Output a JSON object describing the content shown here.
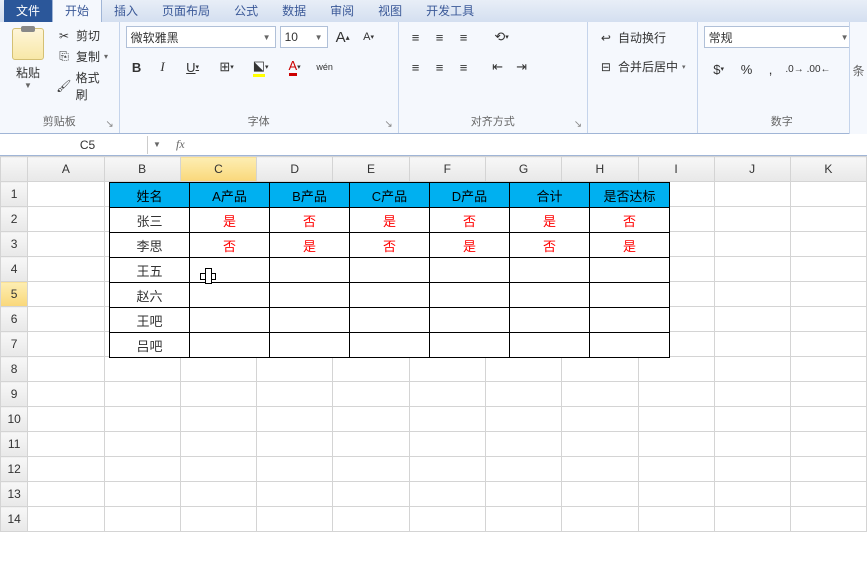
{
  "tabs": {
    "file": "文件",
    "home": "开始",
    "insert": "插入",
    "layout": "页面布局",
    "formula": "公式",
    "data": "数据",
    "review": "审阅",
    "view": "视图",
    "dev": "开发工具"
  },
  "clipboard": {
    "paste": "粘贴",
    "cut": "剪切",
    "copy": "复制",
    "format": "格式刷",
    "label": "剪贴板"
  },
  "font": {
    "name": "微软雅黑",
    "size": "10",
    "label": "字体",
    "wen": "wén"
  },
  "align": {
    "label": "对齐方式",
    "wrap": "自动换行",
    "merge": "合并后居中"
  },
  "number": {
    "label": "数字",
    "format": "常规"
  },
  "right_label": "条",
  "namebox": "C5",
  "headers": [
    "A",
    "B",
    "C",
    "D",
    "E",
    "F",
    "G",
    "H",
    "I",
    "J",
    "K"
  ],
  "table": {
    "header": [
      "姓名",
      "A产品",
      "B产品",
      "C产品",
      "D产品",
      "合计",
      "是否达标"
    ],
    "rows": [
      {
        "name": "张三",
        "v": [
          "是",
          "否",
          "是",
          "否",
          "是",
          "否"
        ]
      },
      {
        "name": "李思",
        "v": [
          "否",
          "是",
          "否",
          "是",
          "否",
          "是"
        ]
      },
      {
        "name": "王五",
        "v": [
          "",
          "",
          "",
          "",
          "",
          ""
        ]
      },
      {
        "name": "赵六",
        "v": [
          "",
          "",
          "",
          "",
          "",
          ""
        ]
      },
      {
        "name": "王吧",
        "v": [
          "",
          "",
          "",
          "",
          "",
          ""
        ]
      },
      {
        "name": "吕吧",
        "v": [
          "",
          "",
          "",
          "",
          "",
          ""
        ]
      }
    ]
  }
}
